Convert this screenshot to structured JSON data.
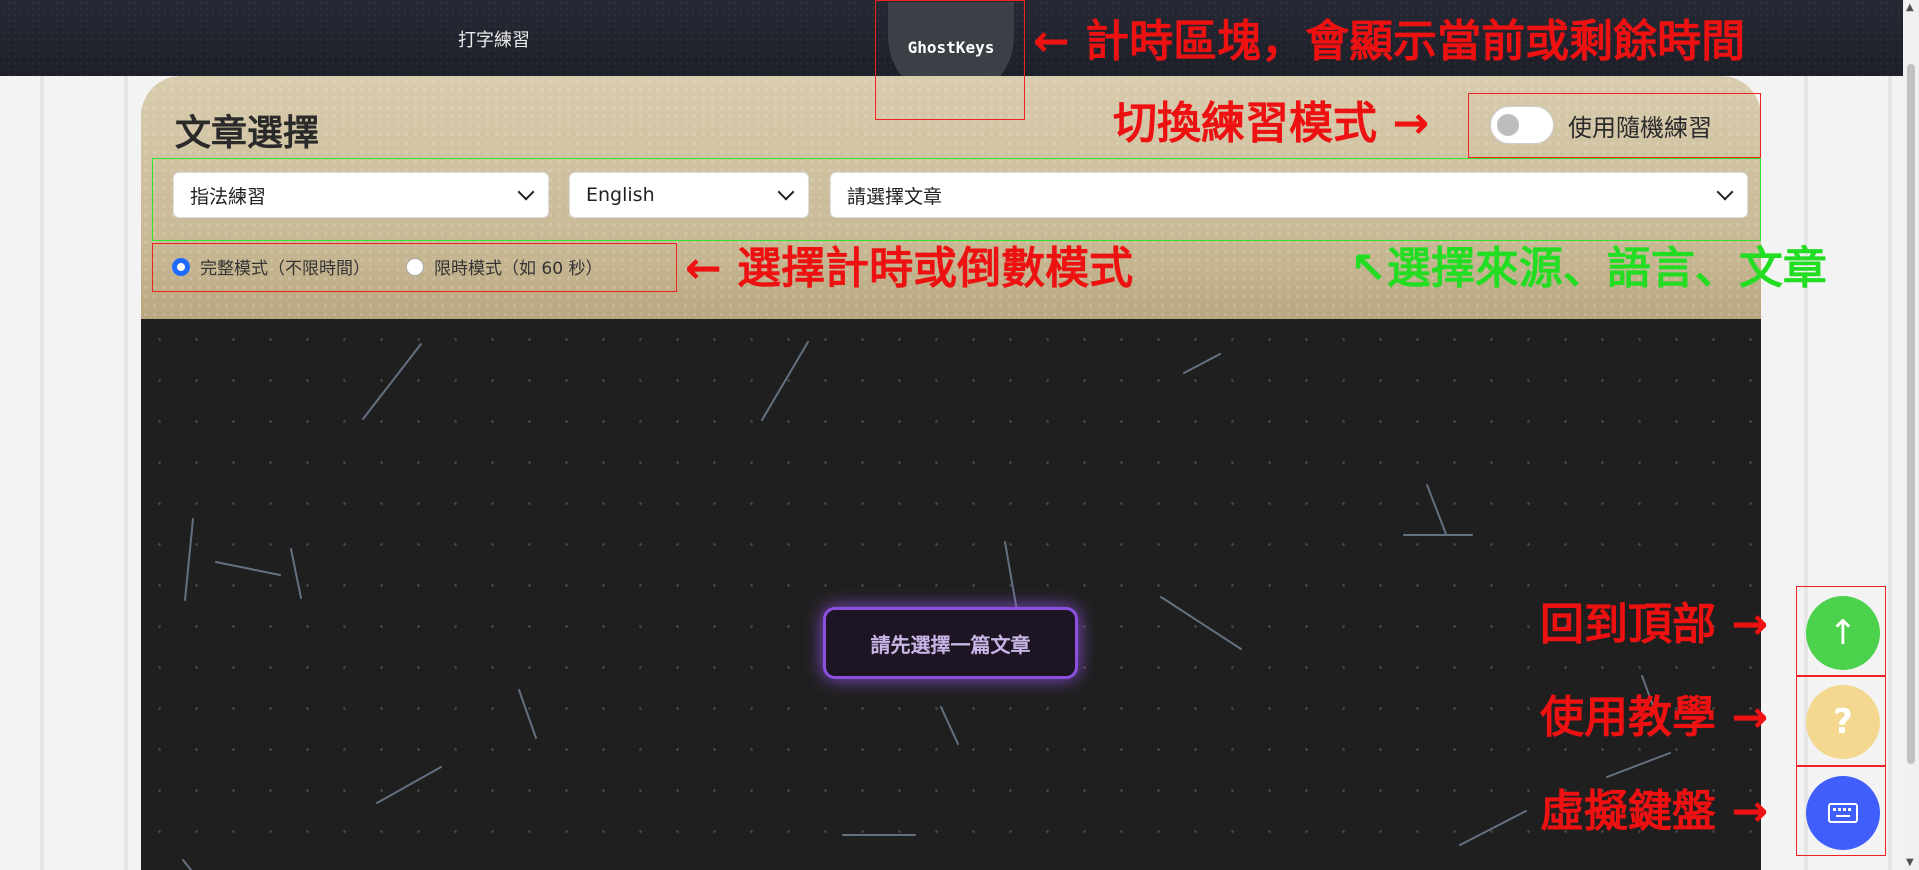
{
  "header": {
    "nav_label": "打字練習",
    "logo": "GhostKeys"
  },
  "panel": {
    "title": "文章選擇",
    "random_toggle_label": "使用隨機練習",
    "selects": {
      "source": "指法練習",
      "language": "English",
      "article": "請選擇文章"
    },
    "modes": {
      "full": "完整模式（不限時間）",
      "timed": "限時模式（如 60 秒）",
      "selected": "full"
    }
  },
  "practice": {
    "prompt": "請先選擇一篇文章"
  },
  "fabs": {
    "top_icon": "↑",
    "help_icon": "?"
  },
  "annotations": {
    "timer": "← 計時區塊，會顯示當前或剩餘時間",
    "toggle": "切換練習模式 →",
    "mode": "← 選擇計時或倒數模式",
    "selectors": "↖選擇來源、語言、文章",
    "back_to_top": "回到頂部 →",
    "tutorial": "使用教學 →",
    "virtual_keyboard": "虛擬鍵盤 →"
  },
  "colors": {
    "annotation_red": "#ee1111",
    "annotation_green": "#22dd22",
    "accent_purple": "#8c4fe0",
    "fab_green": "#4cd14c",
    "fab_yellow": "#f5d88f",
    "fab_blue": "#3f5efb"
  }
}
